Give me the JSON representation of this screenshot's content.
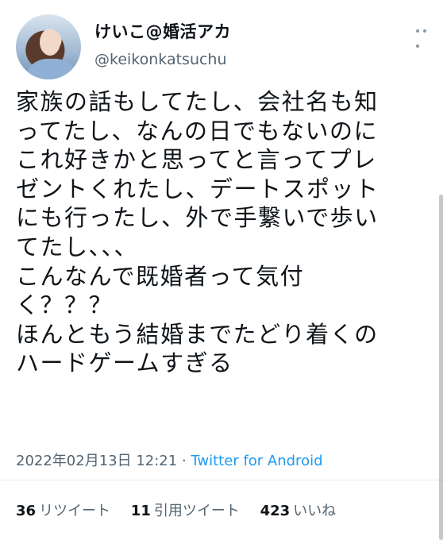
{
  "author": {
    "display_name": "けいこ@婚活アカ",
    "handle": "@keikonkatsuchu"
  },
  "tweet": {
    "text": "家族の話もしてたし、会社名も知\nってたし、なんの日でもないのに\nこれ好きかと思ってと言ってプレ\nゼントくれたし、デートスポット\nにも行ったし、外で手繋いで歩い\nてたし、、、\nこんなんで既婚者って気付\nく？？？\nほんともう結婚までたどり着くの\nハードゲームすぎる",
    "timestamp": "2022年02月13日 12:21",
    "separator": " · ",
    "source": "Twitter for Android"
  },
  "stats": {
    "retweets_count": "36",
    "retweets_label": "リツイート",
    "quotes_count": "11",
    "quotes_label": "引用ツイート",
    "likes_count": "423",
    "likes_label": "いいね"
  },
  "icons": {
    "more": "more-dots-icon"
  },
  "colors": {
    "text": "#0f1419",
    "muted": "#536471",
    "link": "#1d9bf0",
    "divider": "#e6ecf0"
  }
}
